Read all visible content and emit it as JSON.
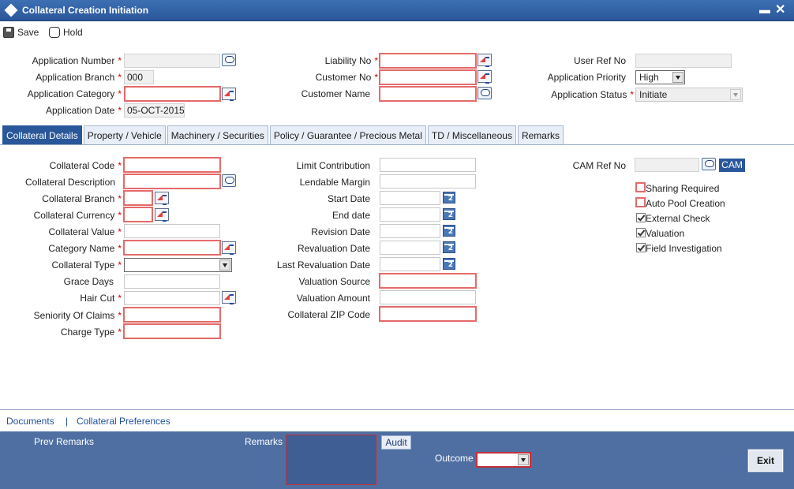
{
  "window": {
    "title": "Collateral Creation Initiation"
  },
  "toolbar": {
    "save_label": "Save",
    "hold_label": "Hold"
  },
  "header": {
    "application_number": {
      "label": "Application Number",
      "value": ""
    },
    "application_branch": {
      "label": "Application Branch",
      "value": "000"
    },
    "application_category": {
      "label": "Application Category",
      "value": ""
    },
    "application_date": {
      "label": "Application Date",
      "value": "05-OCT-2015"
    },
    "liability_no": {
      "label": "Liability No",
      "value": ""
    },
    "customer_no": {
      "label": "Customer No",
      "value": ""
    },
    "customer_name": {
      "label": "Customer Name",
      "value": ""
    },
    "user_ref_no": {
      "label": "User Ref No",
      "value": ""
    },
    "application_priority": {
      "label": "Application Priority",
      "value": "High"
    },
    "application_status": {
      "label": "Application Status",
      "value": "Initiate"
    }
  },
  "tabs": [
    {
      "label": "Collateral Details",
      "active": true
    },
    {
      "label": "Property / Vehicle",
      "active": false
    },
    {
      "label": "Machinery / Securities",
      "active": false
    },
    {
      "label": "Policy / Guarantee / Precious Metal",
      "active": false
    },
    {
      "label": "TD / Miscellaneous",
      "active": false
    },
    {
      "label": "Remarks",
      "active": false
    }
  ],
  "collateral": {
    "collateral_code": "Collateral Code",
    "collateral_description": "Collateral Description",
    "collateral_branch": "Collateral Branch",
    "collateral_currency": "Collateral Currency",
    "collateral_value": "Collateral Value",
    "category_name": "Category Name",
    "collateral_type": "Collateral Type",
    "grace_days": "Grace Days",
    "hair_cut": "Hair Cut",
    "seniority_of_claims": "Seniority Of Claims",
    "charge_type": "Charge Type"
  },
  "middle": {
    "limit_contribution": "Limit Contribution",
    "lendable_margin": "Lendable Margin",
    "start_date": "Start Date",
    "end_date": "End date",
    "revision_date": "Revision Date",
    "revaluation_date": "Revaluation Date",
    "last_revaluation_date": "Last Revaluation Date",
    "valuation_source": "Valuation Source",
    "valuation_amount": "Valuation Amount",
    "collateral_zip_code": "Collateral ZIP Code"
  },
  "right": {
    "cam_ref_no": "CAM Ref No",
    "cam_button": "CAM",
    "checkboxes": [
      {
        "label": "Sharing Required",
        "checked": false
      },
      {
        "label": "Auto Pool Creation",
        "checked": false
      },
      {
        "label": "External Check",
        "checked": true
      },
      {
        "label": "Valuation",
        "checked": true
      },
      {
        "label": "Field Investigation",
        "checked": true
      }
    ]
  },
  "footer_links": {
    "documents": "Documents",
    "separator": "|",
    "collateral_preferences": "Collateral Preferences"
  },
  "footer": {
    "prev_remarks": "Prev Remarks",
    "remarks": "Remarks",
    "audit": "Audit",
    "outcome": "Outcome",
    "exit": "Exit"
  },
  "colors": {
    "title_bar": "#2a579a",
    "footer": "#4f6fa3",
    "mandatory_border": "#e46a6a"
  }
}
